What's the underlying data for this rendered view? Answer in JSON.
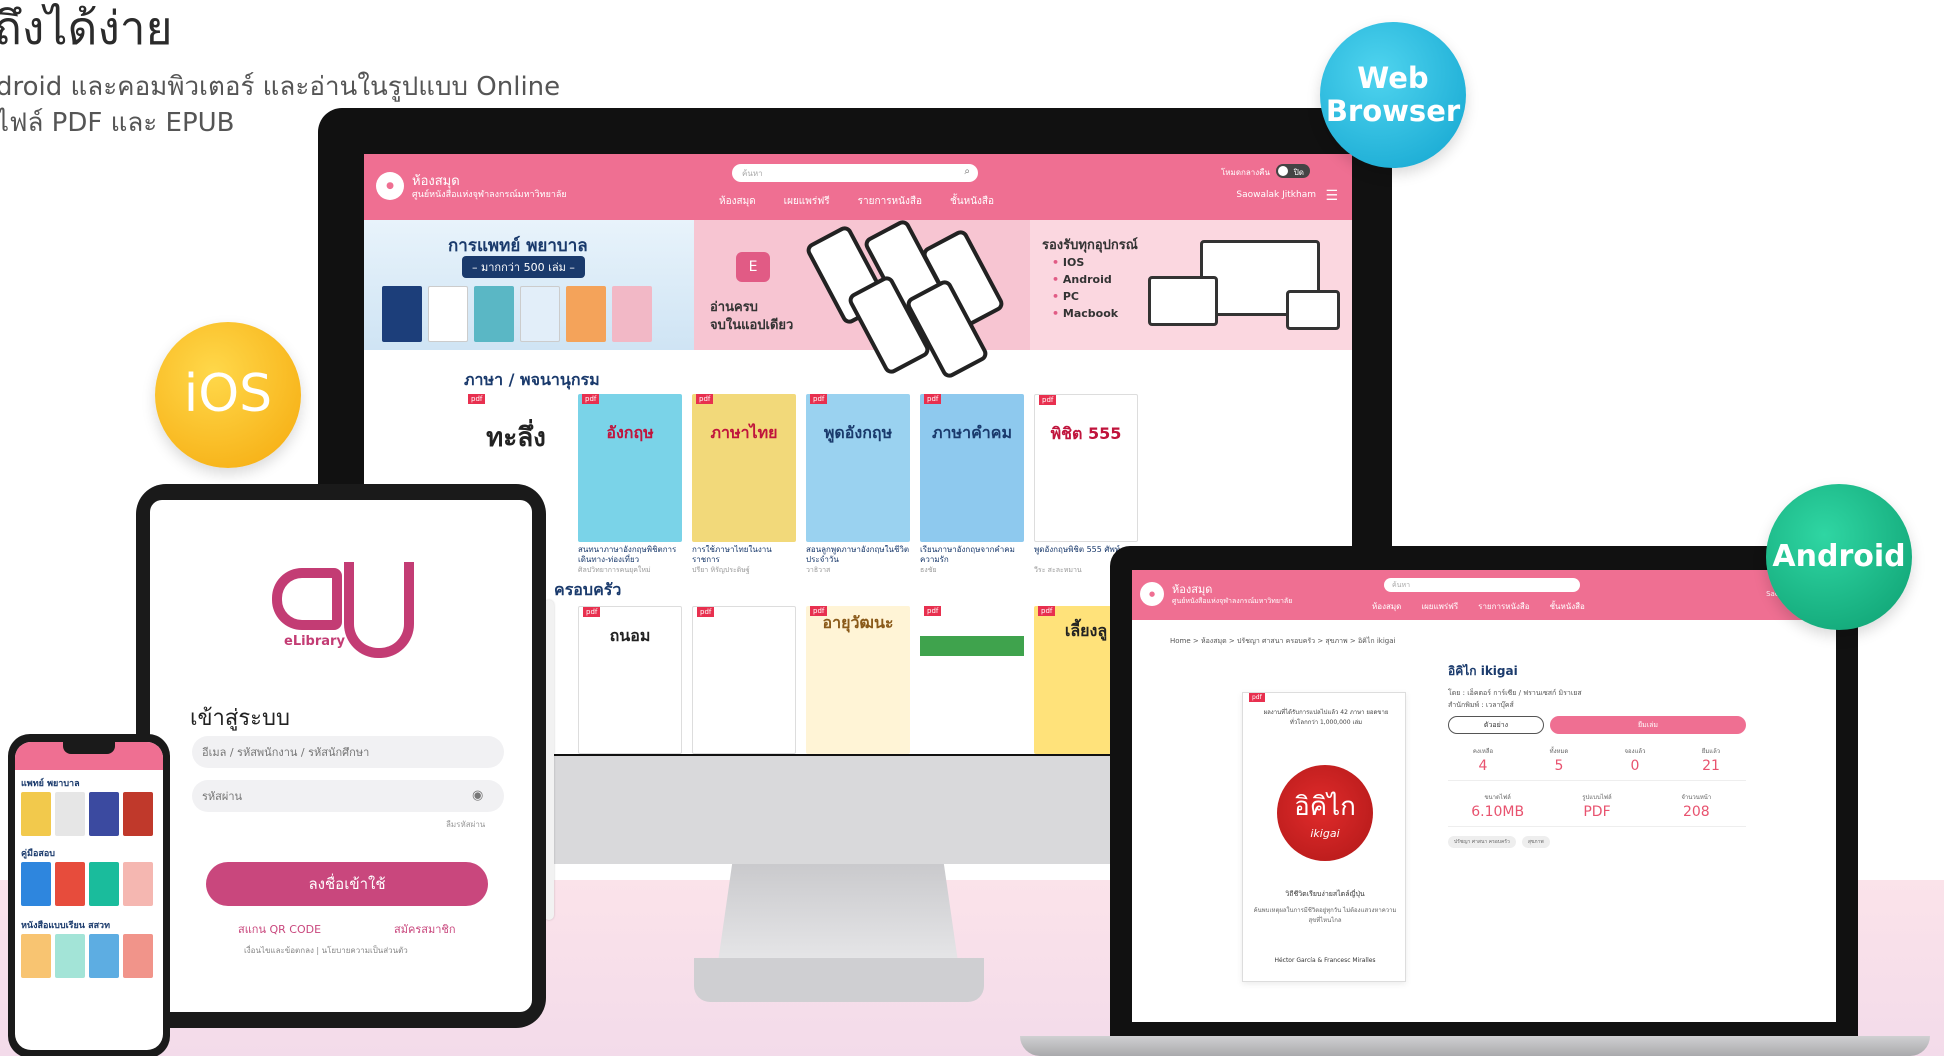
{
  "marketing": {
    "headline": "ถึงได้ง่าย",
    "line1": "droid และคอมพิวเตอร์ และอ่านในรูปแบบ Online",
    "line2": "ไฟล์ PDF และ EPUB"
  },
  "badges": {
    "web": "Web Browser",
    "ios": "iOS",
    "android": "Android"
  },
  "site": {
    "title": "ห้องสมุด",
    "subtitle": "ศูนย์หนังสือแห่งจุฬาลงกรณ์มหาวิทยาลัย",
    "search_placeholder": "ค้นหา",
    "nav": [
      "ห้องสมุด",
      "เผยแพร่ฟรี",
      "รายการหนังสือ",
      "ชั้นหนังสือ"
    ],
    "toggle_label": "โหมดกลางคืน",
    "toggle_value": "ปิด",
    "user": "Saowalak Jitkham"
  },
  "banners": {
    "medical_title": "การแพทย์ พยาบาล",
    "medical_sub": "– มากกว่า 500 เล่ม –",
    "app_line1": "อ่านครบ",
    "app_line2": "จบในแอปเดียว",
    "devices_title": "รองรับทุกอุปกรณ์",
    "devices": [
      "IOS",
      "Android",
      "PC",
      "Macbook"
    ]
  },
  "sections": {
    "language": "ภาษา / พจนานุกรม",
    "family": "ครอบครัว"
  },
  "books": [
    {
      "cover": "ทะลึ่ง",
      "title": "",
      "author": "",
      "color": "#ffffff",
      "text_color": "#222"
    },
    {
      "cover": "อังกฤษ",
      "title": "สนทนาภาษาอังกฤษพิชิตการเดินทาง-ท่องเที่ยว",
      "author": "ศิลปวิทยาการคนยุคใหม่",
      "color": "#7ad3e8",
      "text_color": "#c0143c"
    },
    {
      "cover": "ภาษาไทย",
      "title": "การใช้ภาษาไทยในงานราชการ",
      "author": "ปรียา หิรัญประดิษฐ์",
      "color": "#f2d97a",
      "text_color": "#c0143c"
    },
    {
      "cover": "พูดอังกฤษ",
      "title": "สอนลูกพูดภาษาอังกฤษในชีวิตประจำวัน",
      "author": "วาธิวาส",
      "color": "#9ad2f0",
      "text_color": "#1a3a6c"
    },
    {
      "cover": "ภาษาคำคม",
      "title": "เรียนภาษาอังกฤษจากคำคมความรัก",
      "author": "ธงชัย",
      "color": "#8ec9ee",
      "text_color": "#1a3a6c"
    },
    {
      "cover": "พิชิต 555",
      "title": "พูดอังกฤษพิชิต 555 ศัพท์",
      "author": "วีระ สะละหมาน",
      "color": "#ffffff",
      "text_color": "#c0143c"
    }
  ],
  "family_books": [
    {
      "cover": "ถนอม",
      "color": "#ffffff",
      "text_color": "#222"
    },
    {
      "cover": "",
      "color": "#ffffff",
      "text_color": "#c0143c"
    },
    {
      "cover": "อายุวัฒนะ",
      "color": "#fff4d6",
      "text_color": "#8a5a1a"
    },
    {
      "cover": "",
      "color": "#3fa34d",
      "text_color": "#fff"
    },
    {
      "cover": "เลี้ยงลู",
      "color": "#ffe27a",
      "text_color": "#222"
    }
  ],
  "login": {
    "brand": "eLibrary",
    "title": "เข้าสู่ระบบ",
    "user_placeholder": "อีเมล / รหัสพนักงาน / รหัสนักศึกษา",
    "pass_placeholder": "รหัสผ่าน",
    "forgot": "ลืมรหัสผ่าน",
    "submit": "ลงชื่อเข้าใช้",
    "qr": "สแกน QR CODE",
    "register": "สมัครสมาชิก",
    "terms": "เงื่อนไขและข้อตกลง  |  นโยบายความเป็นส่วนตัว"
  },
  "phone": {
    "sections": [
      "แพทย์ พยาบาล",
      "คู่มือสอบ",
      "หนังสือแบบเรียน สสวท"
    ]
  },
  "detail": {
    "breadcrumb": "Home > ห้องสมุด > ปรัชญา ศาสนา ครอบครัว > สุขภาพ > อิคิไก ikigai",
    "title": "อิคิไก ikigai",
    "cover_top": "ผลงานที่ได้รับการแปลไปแล้ว 42 ภาษา ยอดขายทั่วโลกกว่า 1,000,000 เล่ม",
    "cover_seal": "อิคิไก",
    "cover_seal_sub": "ikigai",
    "cover_desc": "วิถีชีวิตเรียบง่ายสไตล์ญี่ปุ่น",
    "cover_desc2": "ค้นพบเหตุผลในการมีชีวิตอยู่ทุกวัน ไม่ต้องแสวงหาความสุขที่ไหนไกล",
    "cover_authors": "Héctor García & Francesc Miralles",
    "author_line": "โดย : เอ็คตอร์ การ์เซีย / ฟรานเซสก์ มิราเยส",
    "publisher_line": "สำนักพิมพ์ : เวลาบุ๊คส์",
    "sample_btn": "ตัวอย่าง",
    "borrow_btn": "ยืมเล่ม",
    "stats1": [
      {
        "k": "คงเหลือ",
        "v": "4"
      },
      {
        "k": "ทั้งหมด",
        "v": "5"
      },
      {
        "k": "จองแล้ว",
        "v": "0"
      },
      {
        "k": "ยืมแล้ว",
        "v": "21"
      }
    ],
    "stats2": [
      {
        "k": "ขนาดไฟล์",
        "v": "6.10MB"
      },
      {
        "k": "รูปแบบไฟล์",
        "v": "PDF"
      },
      {
        "k": "จำนวนหน้า",
        "v": "208"
      }
    ],
    "tags": [
      "ปรัชญา ศาสนา ครอบครัว",
      "สุขภาพ"
    ]
  }
}
